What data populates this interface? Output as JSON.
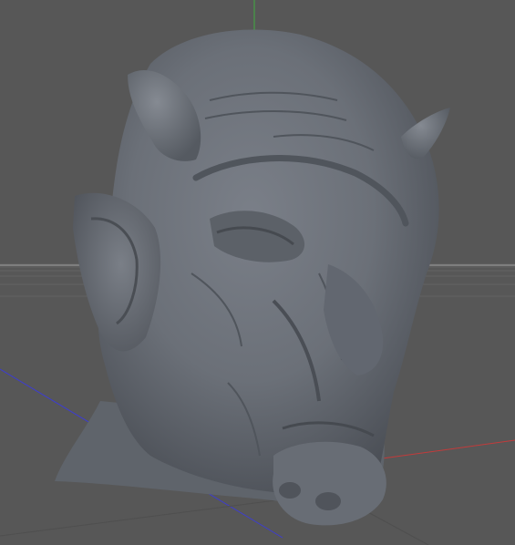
{
  "viewport": {
    "view": "perspective",
    "background_color": "#575757",
    "grid_color": "#666666",
    "horizon_color": "#8a8a8a"
  },
  "axes": {
    "x_color": "#c23b3b",
    "y_color": "#3fae3f",
    "z_color": "#3d3dd0"
  },
  "model": {
    "subject": "demon-head-sculpt",
    "material_color": "#6b7078",
    "shading": "matcap-grey"
  }
}
